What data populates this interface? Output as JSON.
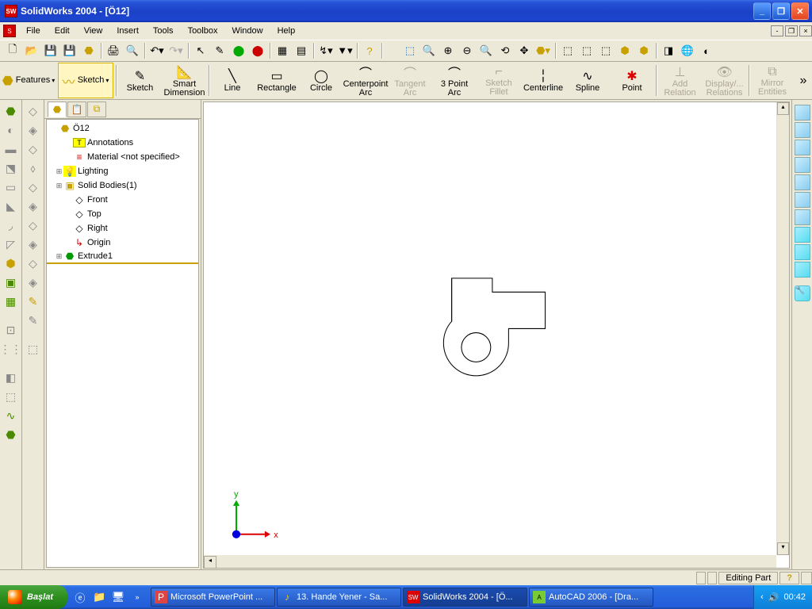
{
  "title": "SolidWorks 2004 - [Ö12]",
  "menu": [
    "File",
    "Edit",
    "View",
    "Insert",
    "Tools",
    "Toolbox",
    "Window",
    "Help"
  ],
  "commandbar": {
    "features": "Features",
    "sketch_btn": "Sketch",
    "sketch": "Sketch",
    "smart_dim": "Smart\nDimension",
    "line": "Line",
    "rectangle": "Rectangle",
    "circle": "Circle",
    "center_arc": "Centerpoint\nArc",
    "tangent_arc": "Tangent\nArc",
    "three_pt_arc": "3 Point Arc",
    "fillet": "Sketch\nFillet",
    "centerline": "Centerline",
    "spline": "Spline",
    "point": "Point",
    "add_rel": "Add\nRelation",
    "disp_rel": "Display/...\nRelations",
    "mirror": "Mirror\nEntities"
  },
  "tree": {
    "root": "Ö12",
    "annotations": "Annotations",
    "material": "Material <not specified>",
    "lighting": "Lighting",
    "solid_bodies": "Solid Bodies(1)",
    "front": "Front",
    "top": "Top",
    "right": "Right",
    "origin": "Origin",
    "extrude": "Extrude1"
  },
  "triad": {
    "x": "x",
    "y": "y"
  },
  "status": {
    "mode": "Editing Part",
    "help": "?"
  },
  "taskbar": {
    "start": "Başlat",
    "tasks": [
      {
        "icon": "📊",
        "label": "Microsoft PowerPoint ..."
      },
      {
        "icon": "🎵",
        "label": "13. Hande Yener - Sa..."
      },
      {
        "icon": "SW",
        "label": "SolidWorks 2004 - [Ö...",
        "active": true
      },
      {
        "icon": "A",
        "label": "AutoCAD 2006 - [Dra..."
      }
    ],
    "clock": "00:42"
  }
}
